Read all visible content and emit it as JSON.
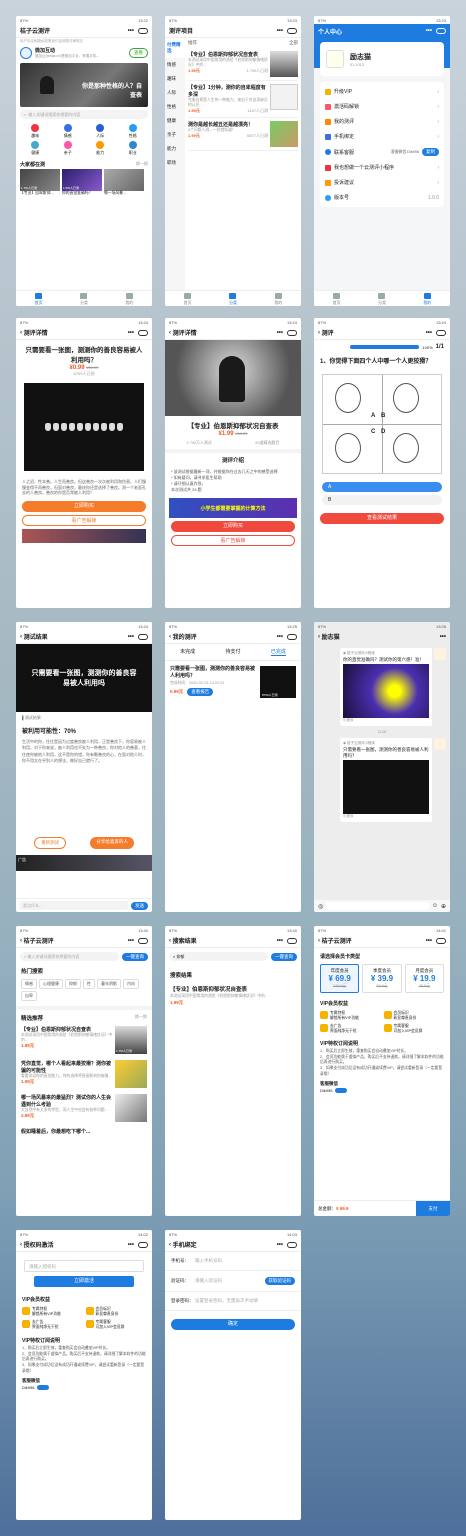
{
  "status": {
    "time_a": "13:22",
    "time_b": "13:23",
    "time_c": "13:24",
    "time_d": "13:25",
    "time_e": "13:26",
    "time_f": "13:40",
    "time_g": "14:01",
    "time_h": "14:02",
    "time_i": "14:03",
    "signal": "87%"
  },
  "home": {
    "title": "桔子云测评",
    "notice": "用户协议和隐私政策我们会按照法律规定",
    "account_name": "微加互动",
    "account_desc": "微加云(weijia.cn)是微加平台，掌握手机...",
    "follow": "查看",
    "banner_text": "你是那种性格的人？自查表",
    "search_placeholder": "输入关键词搜索你想要的内容",
    "categories": [
      "趣味",
      "情感",
      "人际",
      "性格",
      "健康",
      "亲子",
      "能力",
      "职业"
    ],
    "section": "大家都在测",
    "swap": "换一换",
    "cards": [
      {
        "label": "【专业】自卑斯抑...",
        "count": "1.7W人已测"
      },
      {
        "label": "你的直觉准确吗？",
        "count": "1.5W人已测"
      },
      {
        "label": "哪一场风暴...",
        "count": ""
      }
    ],
    "tabs": [
      "首页",
      "分类",
      "我的"
    ]
  },
  "category": {
    "title": "测评项目",
    "side": [
      "付费精选",
      "情感",
      "趣味",
      "人际",
      "性格",
      "健康",
      "亲子",
      "能力",
      "职场"
    ],
    "filter_left": "推荐",
    "filter_right": "全部",
    "items": [
      {
        "title": "【专业】伯恩斯抑郁状况自查表",
        "desc": "本测试采用中国常用的测验《伯恩斯抑郁情绪状况》中的...",
        "price": "1.99元",
        "count": "1.7W人已测"
      },
      {
        "title": "【专业】1分钟，测你的自卑程度有多深",
        "desc": "克服自卑是人生的一种能力，来自于对自身缺点的认识...",
        "price": "1.99元",
        "count": "1147人已测"
      },
      {
        "title": "测你是越长越丑还是越漂亮！",
        "desc": "4个问题人测，一秒就知道！",
        "price": "1.99元",
        "count": "6877人已测"
      }
    ]
  },
  "profile": {
    "title": "个人中心",
    "name": "励志猫",
    "id": "ID:1913",
    "menu": [
      {
        "label": "升级VIP",
        "extra": ""
      },
      {
        "label": "激活码解锁",
        "extra": ""
      },
      {
        "label": "我的测评",
        "extra": ""
      },
      {
        "label": "手机绑定",
        "extra": ""
      },
      {
        "label": "联系客服",
        "extra": "客服微信:Dlk996"
      },
      {
        "label": "我也想做一个云测评小程序",
        "extra": ""
      },
      {
        "label": "投诉建议",
        "extra": ""
      },
      {
        "label": "版本号",
        "extra": "1.0.0"
      }
    ],
    "copy_btn": "复制"
  },
  "detail1": {
    "title": "测评详情",
    "headline": "只需要看一张图，测测你的善良容易被人利用吗？",
    "price": "¥0.99",
    "old": "¥16.00",
    "count": "8769人已测",
    "desc": "人之初，性本善。人生而善良。但这善良一次次被利用和伤害。人们慢慢变得不再善良，但面对善良，最终你还是选择了善良。测一个老面孔去的人善良。善良的你是否常被人利用？",
    "buy": "立即购买",
    "ad": "看广告解锁"
  },
  "detail2": {
    "title": "测评详情",
    "headline": "【专业】伯恩斯抑郁状况自查表",
    "price": "¥1.99",
    "old": "¥66.00",
    "count_a": "1.7W万人测试",
    "count_b": "20道精选题目",
    "intro": "测评介绍",
    "text": "* 该测试根据最新一项，并根据你在过去几天之中的感受选择\n* 如有疑问，请寻求医生帮助\n* 请仔细认真作答。\n本次测试共 25 题",
    "banner": "小学生都需要掌握的计算方法",
    "buy": "立即购买",
    "ad": "看广告解锁"
  },
  "question": {
    "title": "测评",
    "progress_label": "100%",
    "page": "1/1",
    "q": "1、你觉得下面四个人中哪一个人更狡猾？",
    "letters": [
      "A",
      "B",
      "C",
      "D"
    ],
    "options": [
      "A",
      "B"
    ],
    "submit": "查看测试结果"
  },
  "result": {
    "title": "测试结果",
    "banner_text": "只需要看一张图，测测你的善良容易被人利用吗",
    "tag": "测试结果",
    "score": "被利用可能性：70%",
    "body": "生活中的你，往往是因为过度善良被人利用，正是善良下，你容易被人利用，对于你来说，被人利用也不失为一种善良，你对他人的善意，往往使你被他人利用，这不是你的错，你有颗善良的心，在面对他人时，你不用太在乎别人的想法，做好自己就行了。",
    "retry": "重新测试",
    "share": "分享给喜爱的人",
    "input_placeholder": "发点什么...",
    "send": "发送",
    "ad": "广告"
  },
  "mytests": {
    "title": "我的测评",
    "tabs": [
      "未完成",
      "待支付",
      "已完成"
    ],
    "item_title": "只需要看一张图，测测你的善良容易被人利用吗？",
    "time": "完成时间：2020-02-23 13:22:31",
    "price": "0.99元",
    "btn": "查看报告",
    "count": "8769人已测"
  },
  "chat": {
    "title": "励志猫",
    "card1_src": "桔子云测评小程序",
    "card1_title": "你的直觉准确吗？测试你的第六感！准！",
    "time": "13:26",
    "card2_src": "桔子云测评小程序",
    "card2_title": "只需要看一张图，测测你的善良容易被人利用吗？",
    "footer": "小程序"
  },
  "search1": {
    "title": "桔子云测评",
    "placeholder": "输入关键词搜索你想要的内容",
    "btn": "一键查询",
    "hot": "热门搜索",
    "tags": [
      "情感",
      "心理健康",
      "抑郁",
      "性",
      "童年阴影",
      "内向",
      "自卑"
    ],
    "section": "精选推荐",
    "swap": "换一换",
    "items": [
      {
        "title": "【专业】伯恩斯抑郁状况自查表",
        "desc": "本测试采用中国常用的测验《伯恩斯抑郁情绪状况》中的...",
        "price": "1.99元",
        "count": "1.7W人已测"
      },
      {
        "title": "凭你直觉，哪个人看起来最狡猾？测你被骗的可能性",
        "desc": "看看测试你的直觉能力，你的选择将直接影响你被骗...",
        "price": "1.99元",
        "count": ""
      },
      {
        "title": "哪一场风暴来的最猛烈？测试你的人生会遇到什么考验",
        "desc": "大自然中有太多的考验，而人生中也会有各种问题...",
        "price": "2.99元",
        "count": ""
      },
      {
        "title": "假如睡着后，你最想吃下哪个...",
        "desc": "",
        "price": "",
        "count": ""
      }
    ]
  },
  "search2": {
    "title": "搜索结果",
    "query": "抑郁",
    "btn": "一键查询",
    "label": "搜索结果",
    "item_title": "【专业】伯恩斯抑郁状况自查表",
    "item_desc": "本测试采用中国常用的测验《伯恩斯抑郁情绪状况》中的...",
    "price": "1.99元"
  },
  "vip": {
    "title": "桔子云测评",
    "choose": "请选择会员卡类型",
    "plans": [
      {
        "name": "年度会员",
        "price": "¥ 69.9",
        "old": "129.9元"
      },
      {
        "name": "季度会员",
        "price": "¥ 39.9",
        "old": "69.9元"
      },
      {
        "name": "月度会员",
        "price": "¥ 19.9",
        "old": "29.9元"
      }
    ],
    "rights_title": "VIP会员权益",
    "rights": [
      "专属特权\n解锁所有VIP功能",
      "会员标识\n彰显尊贵身份",
      "去广告\n界面纯净无干扰",
      "专属客服\n可加入VIP会员群"
    ],
    "explain_title": "VIP特权订阅说明",
    "explain": "1、购买后立即生效，重复购买会自动叠加VIP时长。\n2、会员功能属于虚拟产品，购买后不支持退款，请详细了解本软件的功能后再进行购买。\n3、如果支付成功后没有成功开通或续费VIP，请尝试重新登录（一定要登录哦）",
    "service": "客服微信",
    "wechat": "Dlk996",
    "total_label": "总金额：",
    "total": "¥ 69.9",
    "pay": "支付"
  },
  "code": {
    "title": "授权码激活",
    "placeholder": "请输入授权码",
    "btn": "立即激活",
    "rights_title": "VIP会员权益",
    "rights": [
      "专属特权\n解锁所有VIP功能",
      "会员标识\n彰显尊贵身份",
      "去广告\n界面纯净无干扰",
      "专属客服\n可加入VIP会员群"
    ],
    "explain_title": "VIP特权订阅说明",
    "explain": "1、购买后立即生效，重复购买会自动叠加VIP时长。\n2、会员功能属于虚拟产品，购买后不支持退款，请详细了解本软件的功能后再进行购买。\n3、如果支付成功后没有成功开通或续费VIP，请尝试重新登录（一定要登录哦）",
    "service": "客服微信",
    "wechat": "Dlk996"
  },
  "bind": {
    "title": "手机绑定",
    "phone_label": "手机号：",
    "phone_ph": "输入手机号码",
    "code_label": "验证码：",
    "code_ph": "请输入验证码",
    "get_code": "获取验证码",
    "pwd_label": "登录密码：",
    "pwd_ph": "设置登录密码，无需再次手动填",
    "confirm": "确定"
  }
}
